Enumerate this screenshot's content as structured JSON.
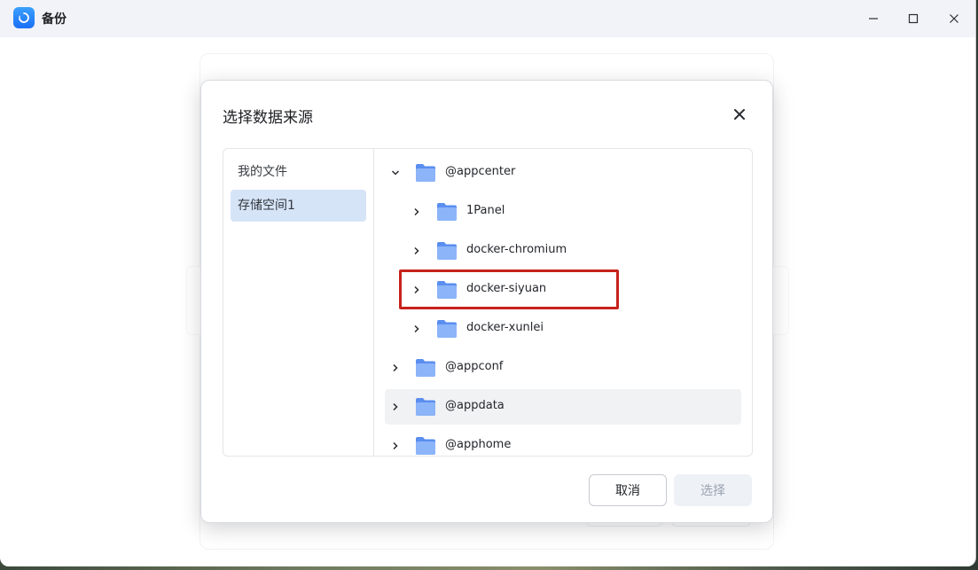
{
  "window": {
    "title": "备份",
    "controls": [
      "minimize-icon",
      "maximize-icon",
      "close-icon"
    ]
  },
  "dialog": {
    "title": "选择数据来源",
    "sidebar": [
      {
        "label": "我的文件",
        "active": false
      },
      {
        "label": "存储空间1",
        "active": true
      }
    ],
    "tree": [
      {
        "label": "@appcenter",
        "level": 0,
        "expanded": true
      },
      {
        "label": "1Panel",
        "level": 1,
        "expanded": false
      },
      {
        "label": "docker-chromium",
        "level": 1,
        "expanded": false
      },
      {
        "label": "docker-siyuan",
        "level": 1,
        "expanded": false,
        "highlighted": true
      },
      {
        "label": "docker-xunlei",
        "level": 1,
        "expanded": false
      },
      {
        "label": "@appconf",
        "level": 0,
        "expanded": false
      },
      {
        "label": "@appdata",
        "level": 0,
        "expanded": false,
        "hover": true
      },
      {
        "label": "@apphome",
        "level": 0,
        "expanded": false
      }
    ],
    "buttons": {
      "cancel": "取消",
      "select": "选择"
    }
  },
  "colors": {
    "folder": "#7aa6f5",
    "folder_tab": "#5a8ef0",
    "accent": "#1b6ff5",
    "highlight": "#c6221c"
  }
}
